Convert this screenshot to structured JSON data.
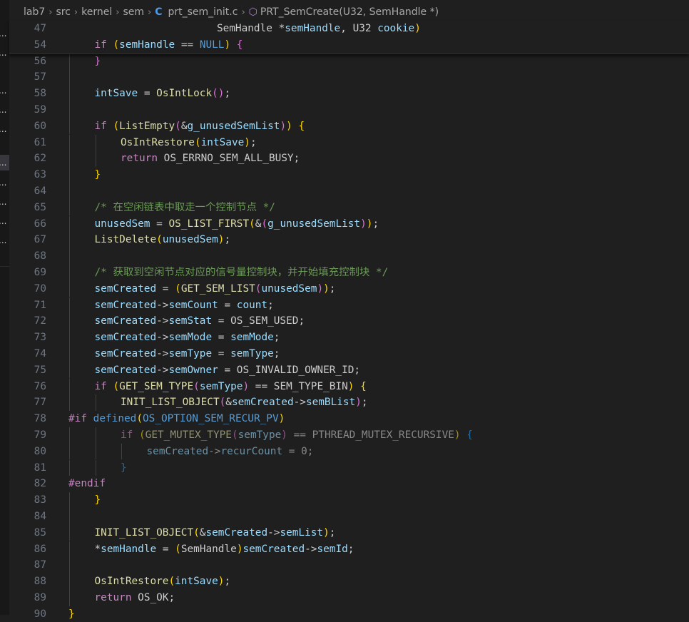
{
  "breadcrumb": {
    "segments": [
      "lab7",
      "src",
      "kernel",
      "sem"
    ],
    "file": "prt_sem_init.c",
    "file_icon": "C",
    "symbol": "PRT_SemCreate(U32, SemHandle *)"
  },
  "sidebar": {
    "items": [
      "...",
      "...",
      "...",
      "...",
      "...",
      "...",
      "...",
      "...",
      "...",
      "..."
    ]
  },
  "editor": {
    "sticky": [
      {
        "num": "47",
        "indent": 0,
        "tokens": [
          [
            "                        ",
            ""
          ],
          [
            "SemHandle",
            "ty"
          ],
          [
            " *",
            ""
          ],
          [
            "semHandle",
            "var"
          ],
          [
            ", ",
            ""
          ],
          [
            "U32",
            "ty"
          ],
          [
            " ",
            ""
          ],
          [
            "cookie",
            "var"
          ],
          [
            ")",
            "pn"
          ]
        ]
      },
      {
        "num": "54",
        "indent": 1,
        "tokens": [
          [
            "if",
            "kwc"
          ],
          [
            " ",
            ""
          ],
          [
            "(",
            "pn"
          ],
          [
            "semHandle",
            "var"
          ],
          [
            " == ",
            ""
          ],
          [
            "NULL",
            "mac"
          ],
          [
            ")",
            "pn"
          ],
          [
            " {",
            "pp"
          ]
        ]
      }
    ],
    "lines": [
      {
        "num": "56",
        "indent": 1,
        "guides": 1,
        "tokens": [
          [
            "}",
            "pp"
          ]
        ]
      },
      {
        "num": "57",
        "indent": 0,
        "guides": 1,
        "tokens": []
      },
      {
        "num": "58",
        "indent": 1,
        "guides": 1,
        "tokens": [
          [
            "intSave",
            "var"
          ],
          [
            " = ",
            ""
          ],
          [
            "OsIntLock",
            "fn"
          ],
          [
            "()",
            "pp"
          ],
          [
            ";",
            ""
          ]
        ]
      },
      {
        "num": "59",
        "indent": 0,
        "guides": 1,
        "tokens": []
      },
      {
        "num": "60",
        "indent": 1,
        "guides": 1,
        "tokens": [
          [
            "if",
            "kwc"
          ],
          [
            " ",
            ""
          ],
          [
            "(",
            "pn"
          ],
          [
            "ListEmpty",
            "fn"
          ],
          [
            "(",
            "pp"
          ],
          [
            "&",
            ""
          ],
          [
            "g_unusedSemList",
            "var"
          ],
          [
            ")",
            "pp"
          ],
          [
            ")",
            "pn"
          ],
          [
            " {",
            "pn"
          ]
        ]
      },
      {
        "num": "61",
        "indent": 2,
        "guides": 2,
        "tokens": [
          [
            "OsIntRestore",
            "fn"
          ],
          [
            "(",
            "pn"
          ],
          [
            "intSave",
            "var"
          ],
          [
            ")",
            "pn"
          ],
          [
            ";",
            ""
          ]
        ]
      },
      {
        "num": "62",
        "indent": 2,
        "guides": 2,
        "tokens": [
          [
            "return",
            "kwc"
          ],
          [
            " ",
            ""
          ],
          [
            "OS_ERRNO_SEM_ALL_BUSY",
            "ty"
          ],
          [
            ";",
            ""
          ]
        ]
      },
      {
        "num": "63",
        "indent": 1,
        "guides": 1,
        "tokens": [
          [
            "}",
            "pn"
          ]
        ]
      },
      {
        "num": "64",
        "indent": 0,
        "guides": 1,
        "tokens": []
      },
      {
        "num": "65",
        "indent": 1,
        "guides": 1,
        "tokens": [
          [
            "/* 在空闲链表中取走一个控制节点 */",
            "cm"
          ]
        ]
      },
      {
        "num": "66",
        "indent": 1,
        "guides": 1,
        "tokens": [
          [
            "unusedSem",
            "var"
          ],
          [
            " = ",
            ""
          ],
          [
            "OS_LIST_FIRST",
            "fn"
          ],
          [
            "(",
            "pn"
          ],
          [
            "&",
            ""
          ],
          [
            "(",
            "pp"
          ],
          [
            "g_unusedSemList",
            "var"
          ],
          [
            ")",
            "pp"
          ],
          [
            ")",
            "pn"
          ],
          [
            ";",
            ""
          ]
        ]
      },
      {
        "num": "67",
        "indent": 1,
        "guides": 1,
        "tokens": [
          [
            "ListDelete",
            "fn"
          ],
          [
            "(",
            "pn"
          ],
          [
            "unusedSem",
            "var"
          ],
          [
            ")",
            "pn"
          ],
          [
            ";",
            ""
          ]
        ]
      },
      {
        "num": "68",
        "indent": 0,
        "guides": 1,
        "tokens": []
      },
      {
        "num": "69",
        "indent": 1,
        "guides": 1,
        "tokens": [
          [
            "/* 获取到空闲节点对应的信号量控制块，并开始填充控制块 */",
            "cm"
          ]
        ]
      },
      {
        "num": "70",
        "indent": 1,
        "guides": 1,
        "tokens": [
          [
            "semCreated",
            "var"
          ],
          [
            " = ",
            ""
          ],
          [
            "(",
            "pn"
          ],
          [
            "GET_SEM_LIST",
            "fn"
          ],
          [
            "(",
            "pp"
          ],
          [
            "unusedSem",
            "var"
          ],
          [
            ")",
            "pp"
          ],
          [
            ")",
            "pn"
          ],
          [
            ";",
            ""
          ]
        ]
      },
      {
        "num": "71",
        "indent": 1,
        "guides": 1,
        "tokens": [
          [
            "semCreated",
            "var"
          ],
          [
            "->",
            ""
          ],
          [
            "semCount",
            "var"
          ],
          [
            " = ",
            ""
          ],
          [
            "count",
            "var"
          ],
          [
            ";",
            ""
          ]
        ]
      },
      {
        "num": "72",
        "indent": 1,
        "guides": 1,
        "tokens": [
          [
            "semCreated",
            "var"
          ],
          [
            "->",
            ""
          ],
          [
            "semStat",
            "var"
          ],
          [
            " = ",
            ""
          ],
          [
            "OS_SEM_USED",
            "ty"
          ],
          [
            ";",
            ""
          ]
        ]
      },
      {
        "num": "73",
        "indent": 1,
        "guides": 1,
        "tokens": [
          [
            "semCreated",
            "var"
          ],
          [
            "->",
            ""
          ],
          [
            "semMode",
            "var"
          ],
          [
            " = ",
            ""
          ],
          [
            "semMode",
            "var"
          ],
          [
            ";",
            ""
          ]
        ]
      },
      {
        "num": "74",
        "indent": 1,
        "guides": 1,
        "tokens": [
          [
            "semCreated",
            "var"
          ],
          [
            "->",
            ""
          ],
          [
            "semType",
            "var"
          ],
          [
            " = ",
            ""
          ],
          [
            "semType",
            "var"
          ],
          [
            ";",
            ""
          ]
        ]
      },
      {
        "num": "75",
        "indent": 1,
        "guides": 1,
        "tokens": [
          [
            "semCreated",
            "var"
          ],
          [
            "->",
            ""
          ],
          [
            "semOwner",
            "var"
          ],
          [
            " = ",
            ""
          ],
          [
            "OS_INVALID_OWNER_ID",
            "ty"
          ],
          [
            ";",
            ""
          ]
        ]
      },
      {
        "num": "76",
        "indent": 1,
        "guides": 1,
        "tokens": [
          [
            "if",
            "kwc"
          ],
          [
            " ",
            ""
          ],
          [
            "(",
            "pn"
          ],
          [
            "GET_SEM_TYPE",
            "fn"
          ],
          [
            "(",
            "pp"
          ],
          [
            "semType",
            "var"
          ],
          [
            ")",
            "pp"
          ],
          [
            " == ",
            ""
          ],
          [
            "SEM_TYPE_BIN",
            "ty"
          ],
          [
            ")",
            "pn"
          ],
          [
            " {",
            "pn"
          ]
        ]
      },
      {
        "num": "77",
        "indent": 2,
        "guides": 2,
        "tokens": [
          [
            "INIT_LIST_OBJECT",
            "fn"
          ],
          [
            "(",
            "pp"
          ],
          [
            "&",
            ""
          ],
          [
            "semCreated",
            "var"
          ],
          [
            "->",
            ""
          ],
          [
            "semBList",
            "var"
          ],
          [
            ")",
            "pp"
          ],
          [
            ";",
            ""
          ]
        ]
      },
      {
        "num": "78",
        "indent": 0,
        "guides": 0,
        "tokens": [
          [
            "#if",
            "kwc"
          ],
          [
            " ",
            ""
          ],
          [
            "defined",
            "kw"
          ],
          [
            "(",
            "pn"
          ],
          [
            "OS_OPTION_SEM_RECUR_PV",
            "mac"
          ],
          [
            ")",
            "pn"
          ]
        ]
      },
      {
        "num": "79",
        "indent": 2,
        "guides": 2,
        "dim": true,
        "tokens": [
          [
            "if",
            "kwc"
          ],
          [
            " ",
            ""
          ],
          [
            "(",
            "pn"
          ],
          [
            "GET_MUTEX_TYPE",
            "fn"
          ],
          [
            "(",
            "pp"
          ],
          [
            "semType",
            "var"
          ],
          [
            ")",
            "pp"
          ],
          [
            " == ",
            ""
          ],
          [
            "PTHREAD_MUTEX_RECURSIVE",
            "ty"
          ],
          [
            ")",
            "pn"
          ],
          [
            " {",
            "pb"
          ]
        ]
      },
      {
        "num": "80",
        "indent": 3,
        "guides": 3,
        "dim": true,
        "tokens": [
          [
            "semCreated",
            "var"
          ],
          [
            "->",
            ""
          ],
          [
            "recurCount",
            "var"
          ],
          [
            " = ",
            ""
          ],
          [
            "0",
            "ty"
          ],
          [
            ";",
            ""
          ]
        ]
      },
      {
        "num": "81",
        "indent": 2,
        "guides": 2,
        "dim": true,
        "tokens": [
          [
            "}",
            "pb"
          ]
        ]
      },
      {
        "num": "82",
        "indent": 0,
        "guides": 0,
        "tokens": [
          [
            "#endif",
            "kwc"
          ]
        ]
      },
      {
        "num": "83",
        "indent": 1,
        "guides": 1,
        "tokens": [
          [
            "}",
            "pn"
          ]
        ]
      },
      {
        "num": "84",
        "indent": 0,
        "guides": 1,
        "tokens": []
      },
      {
        "num": "85",
        "indent": 1,
        "guides": 1,
        "tokens": [
          [
            "INIT_LIST_OBJECT",
            "fn"
          ],
          [
            "(",
            "pn"
          ],
          [
            "&",
            ""
          ],
          [
            "semCreated",
            "var"
          ],
          [
            "->",
            ""
          ],
          [
            "semList",
            "var"
          ],
          [
            ")",
            "pn"
          ],
          [
            ";",
            ""
          ]
        ]
      },
      {
        "num": "86",
        "indent": 1,
        "guides": 1,
        "tokens": [
          [
            "*",
            ""
          ],
          [
            "semHandle",
            "var"
          ],
          [
            " = ",
            ""
          ],
          [
            "(",
            "pn"
          ],
          [
            "SemHandle",
            "ty"
          ],
          [
            ")",
            "pn"
          ],
          [
            "semCreated",
            "var"
          ],
          [
            "->",
            ""
          ],
          [
            "semId",
            "var"
          ],
          [
            ";",
            ""
          ]
        ]
      },
      {
        "num": "87",
        "indent": 0,
        "guides": 1,
        "tokens": []
      },
      {
        "num": "88",
        "indent": 1,
        "guides": 1,
        "tokens": [
          [
            "OsIntRestore",
            "fn"
          ],
          [
            "(",
            "pn"
          ],
          [
            "intSave",
            "var"
          ],
          [
            ")",
            "pn"
          ],
          [
            ";",
            ""
          ]
        ]
      },
      {
        "num": "89",
        "indent": 1,
        "guides": 1,
        "tokens": [
          [
            "return",
            "kwc"
          ],
          [
            " ",
            ""
          ],
          [
            "OS_OK",
            "ty"
          ],
          [
            ";",
            ""
          ]
        ]
      },
      {
        "num": "90",
        "indent": 0,
        "guides": 0,
        "tokens": [
          [
            "}",
            "pn"
          ]
        ]
      }
    ]
  }
}
